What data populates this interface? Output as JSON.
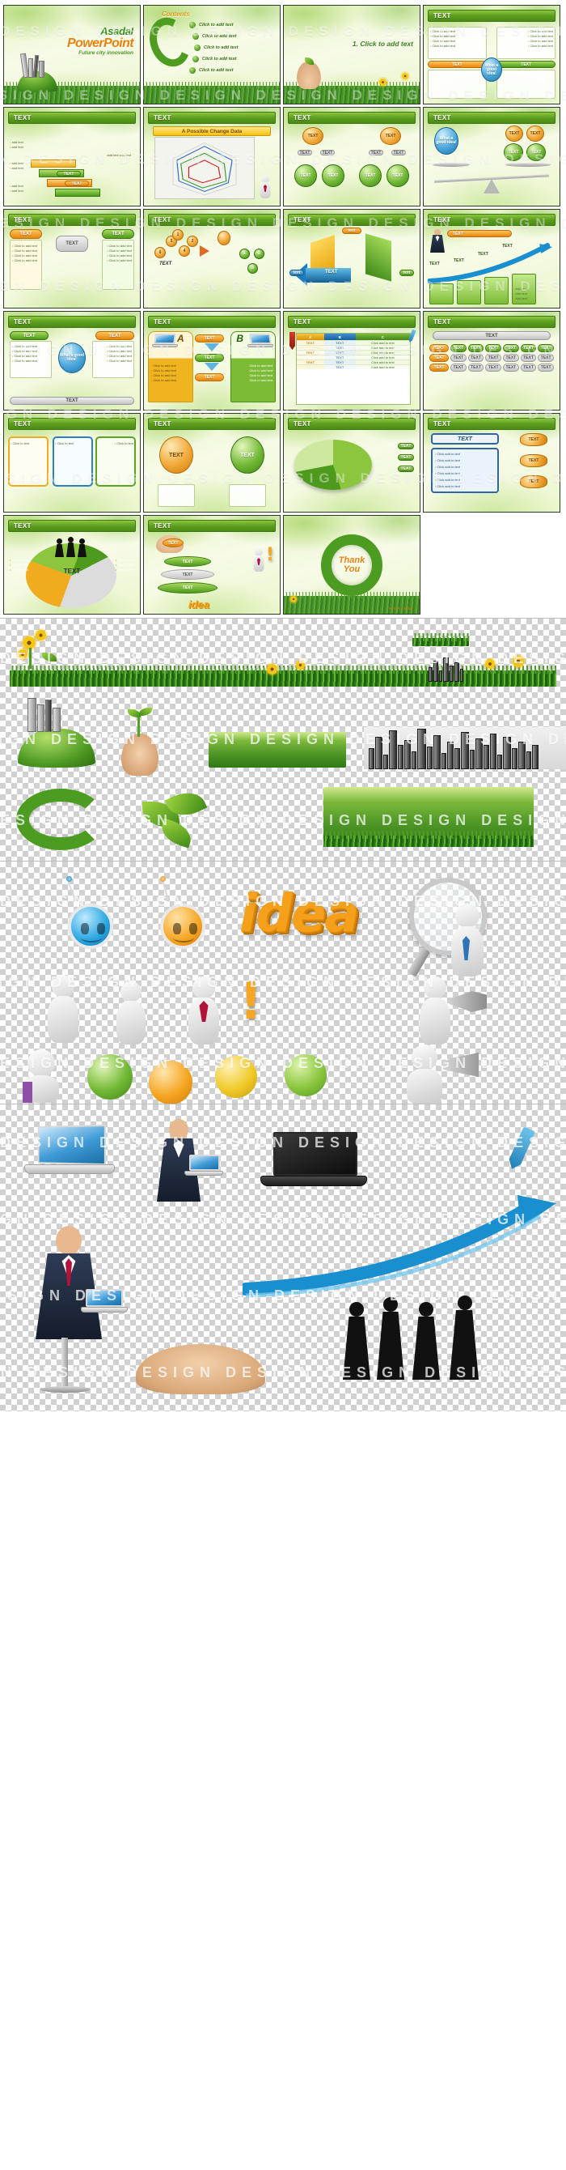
{
  "meta": {
    "product_title": "Asadal PowerPoint",
    "product_tagline": "Future city innovation",
    "watermark_text": "DESIGN DESIGN DESIGN DESIGN DESIGN DESIGN DESIGN DESIGN"
  },
  "common": {
    "text_label": "TEXT",
    "click_to_add_text": "Click to add text",
    "click_add_to_text": "Click add to text",
    "add_text": "Add text",
    "add_text_add_text": "add text add text",
    "text_lower": "text",
    "good_idea": "What a good idea!"
  },
  "slides": [
    {
      "index": 1,
      "kind": "title",
      "title_line1": "Asadal",
      "title_line2": "PowerPoint",
      "subtitle": "Future city innovation"
    },
    {
      "index": 2,
      "kind": "contents",
      "heading": "Contents",
      "items": [
        "Click to add text",
        "Click to add text",
        "Click to add text",
        "Click to add text",
        "Click to add text"
      ]
    },
    {
      "index": 3,
      "kind": "section-divider",
      "heading": "1. Click to add text"
    },
    {
      "index": 4,
      "kind": "two-panel",
      "title": "TEXT",
      "left_tab": "TEXT",
      "right_tab": "TEXT",
      "bullets": [
        "Click to add text",
        "Click to add text",
        "Click to add text",
        "Click to add text"
      ]
    },
    {
      "index": 5,
      "kind": "steps-stairs",
      "title": "TEXT",
      "labels": [
        "add text",
        "add text",
        "add text add text",
        "TEXT"
      ]
    },
    {
      "index": 6,
      "kind": "radar-chart",
      "title": "TEXT",
      "banner": "A Possible Change Data"
    },
    {
      "index": 7,
      "kind": "org-tree",
      "title": "TEXT",
      "nodes": [
        "TEXT",
        "TEXT",
        "TEXT",
        "TEXT",
        "TEXT",
        "TEXT"
      ]
    },
    {
      "index": 8,
      "kind": "balance-scale",
      "title": "TEXT",
      "center": "What a good idea!",
      "nodes": [
        "TEXT",
        "TEXT",
        "TEXT",
        "TEXT"
      ]
    },
    {
      "index": 9,
      "kind": "compare-two",
      "title": "TEXT",
      "left": "TEXT",
      "middle": "TEXT",
      "right": "TEXT",
      "bullets": [
        "Click to add text",
        "Click to add text",
        "Click to add text",
        "Click to add text"
      ]
    },
    {
      "index": 10,
      "kind": "numbered-flow",
      "title": "TEXT",
      "numbers": [
        "1",
        "2",
        "3",
        "4",
        "5",
        "6"
      ],
      "label": "TEXT"
    },
    {
      "index": 11,
      "kind": "cycle-arrows",
      "title": "TEXT",
      "labels": [
        "text",
        "TEXT",
        "TEXT",
        "text"
      ]
    },
    {
      "index": 12,
      "kind": "growth-arrow",
      "title": "TEXT",
      "header_pill": "TEXT",
      "milestones": [
        "TEXT",
        "TEXT",
        "TEXT",
        "TEXT"
      ],
      "cards": [
        "Add text",
        "Add text",
        "Add text",
        "Add text"
      ]
    },
    {
      "index": 13,
      "kind": "center-circle",
      "title": "TEXT",
      "left_tab": "TEXT",
      "right_tab": "TEXT",
      "center": "What a good idea!",
      "footer": "TEXT",
      "bullets": [
        "Click to add text",
        "Click to add text",
        "Click to add text",
        "Click to add text"
      ]
    },
    {
      "index": 14,
      "kind": "ab-compare",
      "title": "TEXT",
      "letter_a": "A",
      "letter_b": "B",
      "steps": [
        "TEXT",
        "TEXT",
        "TEXT"
      ],
      "bullets": [
        "Click to add text",
        "Click to add text",
        "Click to add text",
        "Click to add text"
      ]
    },
    {
      "index": 15,
      "kind": "data-table",
      "title": "TEXT",
      "columns": [
        "A",
        "B",
        "C"
      ],
      "rows": [
        [
          "TEXT",
          "TEXT",
          "Click add to text"
        ],
        [
          "TEXT",
          "TEXT",
          "Click add to text"
        ],
        [
          "TEXT",
          "TEXT",
          "Click add to text"
        ],
        [
          "TEXT",
          "TEXT",
          "Click add to text"
        ],
        [
          "TEXT",
          "TEXT",
          "Click add to text"
        ],
        [
          "TEXT",
          "TEXT",
          "Click add to text"
        ]
      ]
    },
    {
      "index": 16,
      "kind": "matrix-table",
      "title": "TEXT",
      "header": "TEXT",
      "row_label": "TEXT",
      "cells": [
        "TEXT",
        "TEXT",
        "TEXT",
        "TEXT",
        "TEXT",
        "TEXT"
      ]
    },
    {
      "index": 17,
      "kind": "three-card",
      "title": "TEXT",
      "cards": [
        "Click to text",
        "Click to text",
        "Click to text"
      ]
    },
    {
      "index": 18,
      "kind": "two-sphere",
      "title": "TEXT",
      "spheres": [
        "TEXT",
        "TEXT"
      ]
    },
    {
      "index": 19,
      "kind": "pie-chart",
      "title": "TEXT",
      "legend": [
        "TEXT",
        "TEXT",
        "TEXT"
      ]
    },
    {
      "index": 20,
      "kind": "list-panel",
      "title": "TEXT",
      "head": "TEXT",
      "bullets": [
        "Click add to text",
        "Click add to text",
        "Click add to text",
        "Click add to text",
        "Click add to text",
        "Click add to text"
      ],
      "side_nodes": [
        "TEXT",
        "TEXT",
        "TEXT"
      ]
    },
    {
      "index": 21,
      "kind": "team-pie",
      "title": "TEXT",
      "center": "TEXT",
      "bullets": [
        "Click to text",
        "Click to text",
        "Click to text",
        "Click to text",
        "Click to text",
        "Click to text"
      ]
    },
    {
      "index": 22,
      "kind": "layer-stack",
      "title": "TEXT",
      "layers": [
        "TEXT",
        "TEXT",
        "TEXT"
      ],
      "word": "idea"
    },
    {
      "index": 23,
      "kind": "thank-you",
      "line1": "Thank",
      "line2": "You",
      "logo": "YOUR LOGO"
    }
  ],
  "asset_sections": [
    {
      "name": "nature-elements",
      "items": [
        "sunflower-cluster",
        "grass-strip",
        "flower-meadow-strip",
        "green-hill-city",
        "hand-with-sprout",
        "daisy-field",
        "eco-ring",
        "green-leaves",
        "city-skyline-dark",
        "grass-field-photo"
      ]
    },
    {
      "name": "character-elements",
      "items": [
        "blue-smiley-bot",
        "orange-smiley-bot",
        "idea-3d-word",
        "magnifier-with-mannequin",
        "mannequin-group",
        "exclamation-mark",
        "green-sphere-character",
        "orange-sphere-character",
        "yellow-sphere-character",
        "mannequin-with-megaphone"
      ]
    },
    {
      "name": "business-elements",
      "items": [
        "silver-laptop",
        "businessman-with-laptop",
        "black-laptop",
        "blue-growth-arrow",
        "businessman-on-stool",
        "team-silhouettes",
        "open-hand-palm",
        "pen-icon"
      ]
    }
  ]
}
